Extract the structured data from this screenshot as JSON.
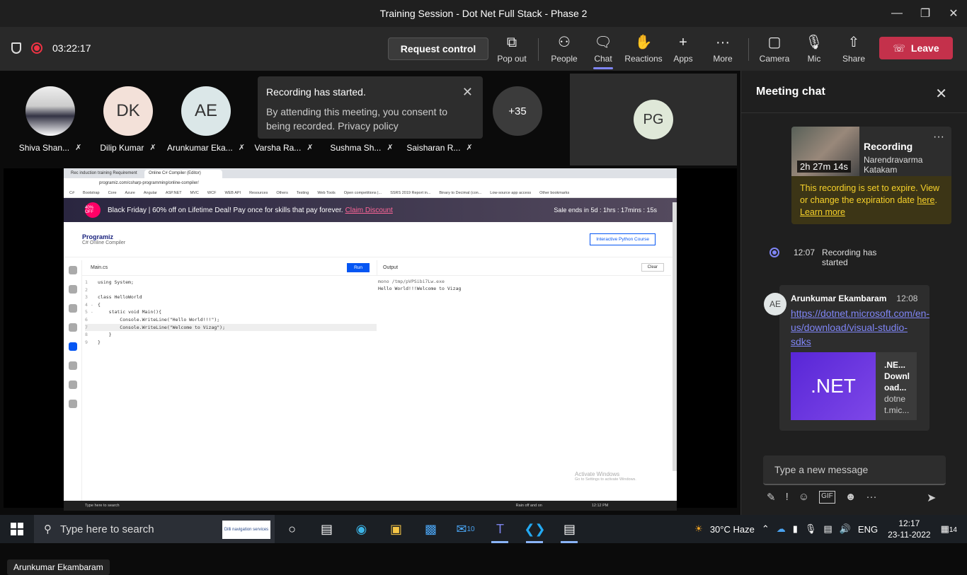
{
  "window": {
    "title": "Training Session - Dot Net Full Stack - Phase 2"
  },
  "toolbar": {
    "elapsed": "03:22:17",
    "request_control": "Request control",
    "popout": "Pop out",
    "people": "People",
    "chat": "Chat",
    "reactions": "Reactions",
    "apps": "Apps",
    "more": "More",
    "camera": "Camera",
    "mic": "Mic",
    "share": "Share",
    "leave": "Leave"
  },
  "participants": [
    {
      "name": "Shiva Shan...",
      "initials": ""
    },
    {
      "name": "Dilip Kumar",
      "initials": "DK"
    },
    {
      "name": "Arunkumar Eka...",
      "initials": "AE"
    },
    {
      "name": "Varsha Ra..."
    },
    {
      "name": "Sushma Sh..."
    },
    {
      "name": "Saisharan R..."
    }
  ],
  "overflow_count": "+35",
  "pinned_tile": {
    "initials": "PG"
  },
  "toast": {
    "title": "Recording has started.",
    "body": "By attending this meeting, you consent to being recorded. Privacy policy"
  },
  "shared_screen": {
    "tabs": [
      "Rec induction training Requirement",
      "Online C# Compiler (Editor)"
    ],
    "url": "programiz.com/csharp-programming/online-compiler/",
    "bookmarks": [
      "C#",
      "Bootstrap",
      "Core",
      "Azure",
      "Angular",
      "ASP.NET",
      "MVC",
      "WCF",
      "WEB API",
      "Resources",
      "Others",
      "Testing",
      "Web Tools",
      "Open competitions |...",
      "SSRS 2019 Report in...",
      "Binary to Decimal (con...",
      "Low-source app access",
      "Other bookmarks"
    ],
    "promo_badge": "40% OFF",
    "promo_text": "Black Friday | 60% off on Lifetime Deal! Pay once for skills that pay forever.",
    "promo_link": "Claim Discount",
    "promo_timer": "Sale ends in 5d : 1hrs : 17mins : 15s",
    "logo": "Programiz",
    "logo_sub": "C# Online Compiler",
    "course_button": "Interactive Python Course",
    "file_tab": "Main.cs",
    "run": "Run",
    "output_label": "Output",
    "clear": "Clear",
    "code_lines": [
      {
        "n": "1",
        "t": "using System;"
      },
      {
        "n": "2",
        "t": ""
      },
      {
        "n": "3",
        "t": "class HelloWorld"
      },
      {
        "n": "4 -",
        "t": "{"
      },
      {
        "n": "5 -",
        "t": "    static void Main(){"
      },
      {
        "n": "6",
        "t": "        Console.WriteLine(\"Hello World!!!\");"
      },
      {
        "n": "7",
        "t": "        Console.WriteLine(\"Welcome to Vizag\");"
      },
      {
        "n": "8",
        "t": "    }"
      },
      {
        "n": "9",
        "t": "}"
      }
    ],
    "output_lines": [
      "mono /tmp/pVPSibi7Lw.exe",
      "Hello World!!!Welcome to Vizag"
    ],
    "activate_title": "Activate Windows",
    "activate_sub": "Go to Settings to activate Windows.",
    "inner_search": "Type here to search",
    "inner_status": "Rain off and on",
    "inner_time": "12:12 PM",
    "inner_date": "23-11-2022"
  },
  "speaker_name": "Arunkumar Ekambaram",
  "chat": {
    "title": "Meeting chat",
    "recording_duration": "2h 27m 14s",
    "recording_title": "Recording",
    "recording_by": "Narendravarma Katakam",
    "expire_text": "This recording is set to expire. View or change the expiration date",
    "expire_here": "here",
    "learn_more": "Learn more",
    "sys_time": "12:07",
    "sys_text": "Recording has started",
    "msg_initials": "AE",
    "msg_author": "Arunkumar Ekambaram",
    "msg_time": "12:08",
    "msg_link": "https://dotnet.microsoft.com/en-us/download/visual-studio-sdks",
    "preview_logo": ".NET",
    "preview_title": ".NE... Downl oad...",
    "preview_domain": "dotne t.mic...",
    "input_placeholder": "Type a new message"
  },
  "taskbar": {
    "search": "Type here to search",
    "search_promo": "Dilli navigation services",
    "weather": "30°C  Haze",
    "lang": "ENG",
    "time": "12:17",
    "date": "23-11-2022",
    "notifications": "14",
    "mail_badge": "10"
  }
}
